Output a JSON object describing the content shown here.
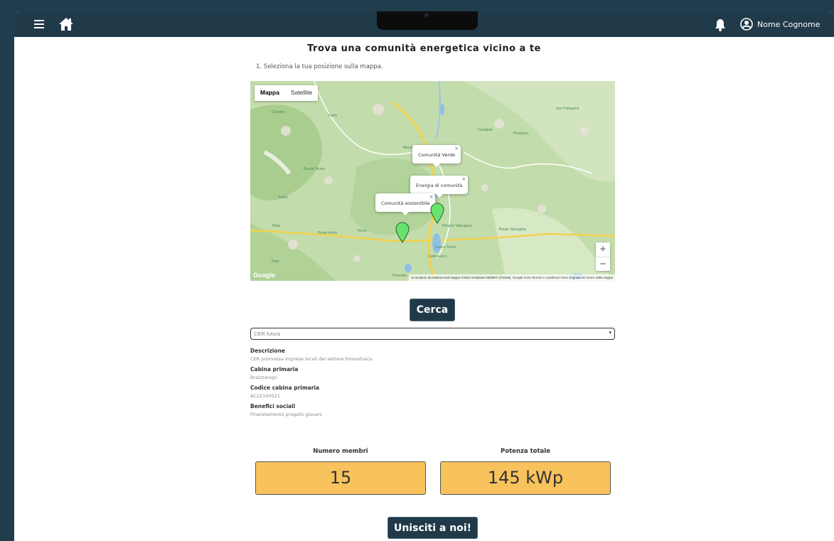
{
  "header": {
    "menu_icon": "hamburger-menu-icon",
    "home_icon": "home-icon",
    "bell_icon": "bell-icon",
    "user_icon": "user-circle-icon",
    "user_name": "Nome Cognome",
    "bg_color": "#213a4a"
  },
  "page": {
    "title": "Trova una comunità energetica vicino a te",
    "step": "1. Seleziona la tua posizione sulla mappa."
  },
  "map": {
    "type_options": [
      "Mappa",
      "Satellite"
    ],
    "selected_type": "Mappa",
    "popups": [
      "Comunità Verde",
      "Energia di comunità",
      "Comunità sostenibile"
    ],
    "zoom_in": "+",
    "zoom_out": "−",
    "brand": "Google",
    "attribution": "Scorciatoie da tastiera   Dati mappa ©2024 GeoBasis-DE/BKG (©2009), Google   5 km   Termini e condizioni d'uso   Segnala un errore nella mappa",
    "place_labels": [
      "Cologno",
      "Darfo",
      "Boario Terme",
      "Edolo",
      "Tione",
      "Riva",
      "Mezzolombardo",
      "Cavalese",
      "Predazzo",
      "Pergine Valsugana",
      "Levico Terme",
      "Caldonazzo",
      "Borgo Valsugana",
      "Rovereto",
      "Ponte Arche",
      "Trento",
      "San Pellegrino"
    ],
    "pin_color": "#67e36d"
  },
  "search_button": "Cerca",
  "cer_select": {
    "value": "CER futura"
  },
  "details": [
    {
      "label": "Descrizione",
      "value": "CER promossa imprese locali del settore fotovoltaico."
    },
    {
      "label": "Cabina primaria",
      "value": "Braizzanigo"
    },
    {
      "label": "Codice cabina primaria",
      "value": "AC22100021"
    },
    {
      "label": "Benefici sociali",
      "value": "Finanziamento progetti giovani"
    }
  ],
  "stats": {
    "members_label": "Numero membri",
    "members_value": "15",
    "power_label": "Potenza totale",
    "power_value": "145 kWp",
    "box_color": "#f8c35c"
  },
  "join_button": "Unisciti a noi!"
}
